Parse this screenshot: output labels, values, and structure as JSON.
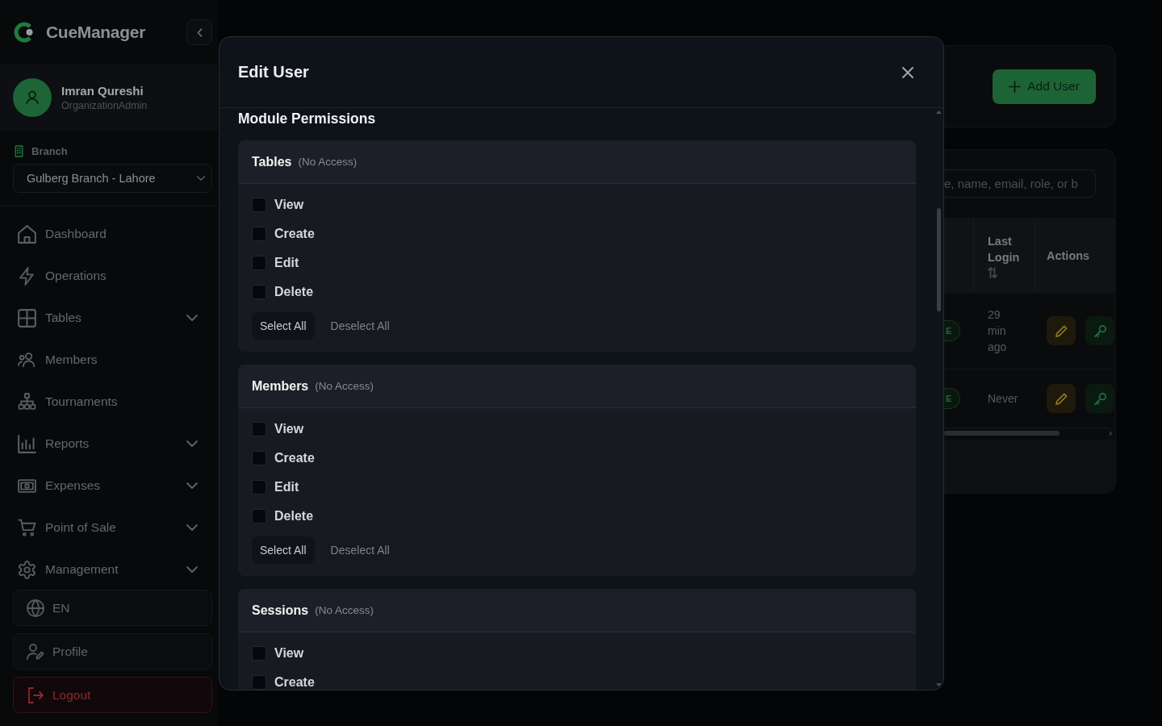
{
  "sidebar": {
    "brand": "CueManager",
    "user": {
      "name": "Imran Qureshi",
      "role": "OrganizationAdmin"
    },
    "branch": {
      "label": "Branch",
      "value": "Gulberg Branch - Lahore"
    },
    "nav": [
      {
        "label": "Dashboard",
        "expandable": false
      },
      {
        "label": "Operations",
        "expandable": false
      },
      {
        "label": "Tables",
        "expandable": true
      },
      {
        "label": "Members",
        "expandable": false
      },
      {
        "label": "Tournaments",
        "expandable": false
      },
      {
        "label": "Reports",
        "expandable": true
      },
      {
        "label": "Expenses",
        "expandable": true
      },
      {
        "label": "Point of Sale",
        "expandable": true
      },
      {
        "label": "Management",
        "expandable": true
      }
    ],
    "footer": [
      {
        "kind": "language",
        "label": "EN"
      },
      {
        "kind": "profile",
        "label": "Profile"
      },
      {
        "kind": "logout",
        "label": "Logout"
      }
    ]
  },
  "modal": {
    "title": "Edit User",
    "section_title": "Module Permissions",
    "modules": [
      {
        "name": "Tables",
        "access": "(No Access)",
        "permissions": [
          {
            "label": "View",
            "checked": false
          },
          {
            "label": "Create",
            "checked": false
          },
          {
            "label": "Edit",
            "checked": false
          },
          {
            "label": "Delete",
            "checked": false
          }
        ],
        "actions": [
          "Select All",
          "Deselect All"
        ]
      },
      {
        "name": "Members",
        "access": "(No Access)",
        "permissions": [
          {
            "label": "View",
            "checked": false
          },
          {
            "label": "Create",
            "checked": false
          },
          {
            "label": "Edit",
            "checked": false
          },
          {
            "label": "Delete",
            "checked": false
          }
        ],
        "actions": [
          "Select All",
          "Deselect All"
        ]
      },
      {
        "name": "Sessions",
        "access": "(No Access)",
        "permissions": [
          {
            "label": "View",
            "checked": false
          },
          {
            "label": "Create",
            "checked": false
          }
        ]
      }
    ]
  },
  "page": {
    "add_button": "Add User",
    "search": {
      "placeholder": "e, name, email, role, or b"
    },
    "table": {
      "columns": [
        {
          "label": "Last Login",
          "sortable": true
        },
        {
          "label": "Actions",
          "sortable": false
        }
      ],
      "rows": [
        {
          "badge": "E",
          "last_login": "29 min ago"
        },
        {
          "badge": "E",
          "last_login": "Never"
        }
      ]
    }
  }
}
